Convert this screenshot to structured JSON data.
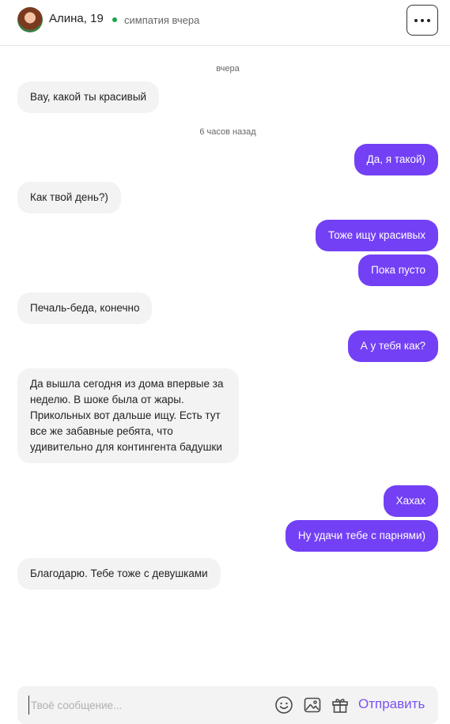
{
  "header": {
    "contact_name": "Алина, 19",
    "match_status": "симпатия вчера",
    "more_icon": "more-horizontal-icon"
  },
  "timeline": [
    {
      "kind": "separator",
      "text": "вчера"
    },
    {
      "kind": "message",
      "from": "them",
      "text": "Вау, какой ты красивый"
    },
    {
      "kind": "separator",
      "text": "6 часов назад"
    },
    {
      "kind": "message",
      "from": "me",
      "text": "Да, я такой)"
    },
    {
      "kind": "message",
      "from": "them",
      "text": "Как твой день?)"
    },
    {
      "kind": "message",
      "from": "me",
      "text": "Тоже ищу красивых"
    },
    {
      "kind": "message",
      "from": "me",
      "text": "Пока пусто"
    },
    {
      "kind": "message",
      "from": "them",
      "text": "Печаль-беда, конечно"
    },
    {
      "kind": "message",
      "from": "me",
      "text": "А у тебя как?"
    },
    {
      "kind": "message",
      "from": "them",
      "text": "Да вышла сегодня из дома впервые за неделю. В шоке была от жары. Прикольных вот дальше ищу. Есть тут все же забавные ребята, что удивительно для контингента бадушки"
    },
    {
      "kind": "message",
      "from": "me",
      "text": "Хахах"
    },
    {
      "kind": "message",
      "from": "me",
      "text": "Ну удачи тебе с парнями)"
    },
    {
      "kind": "message",
      "from": "them",
      "text": "Благодарю. Тебе тоже с девушками"
    }
  ],
  "composer": {
    "placeholder": "Твоё сообщение...",
    "value": "",
    "send_label": "Отправить",
    "icons": [
      "emoji-icon",
      "image-icon",
      "gift-icon"
    ]
  },
  "colors": {
    "outgoing_bubble": "#7340f5",
    "incoming_bubble": "#f3f3f3",
    "online_dot": "#1aa34a",
    "send_text": "#7a52f0"
  }
}
